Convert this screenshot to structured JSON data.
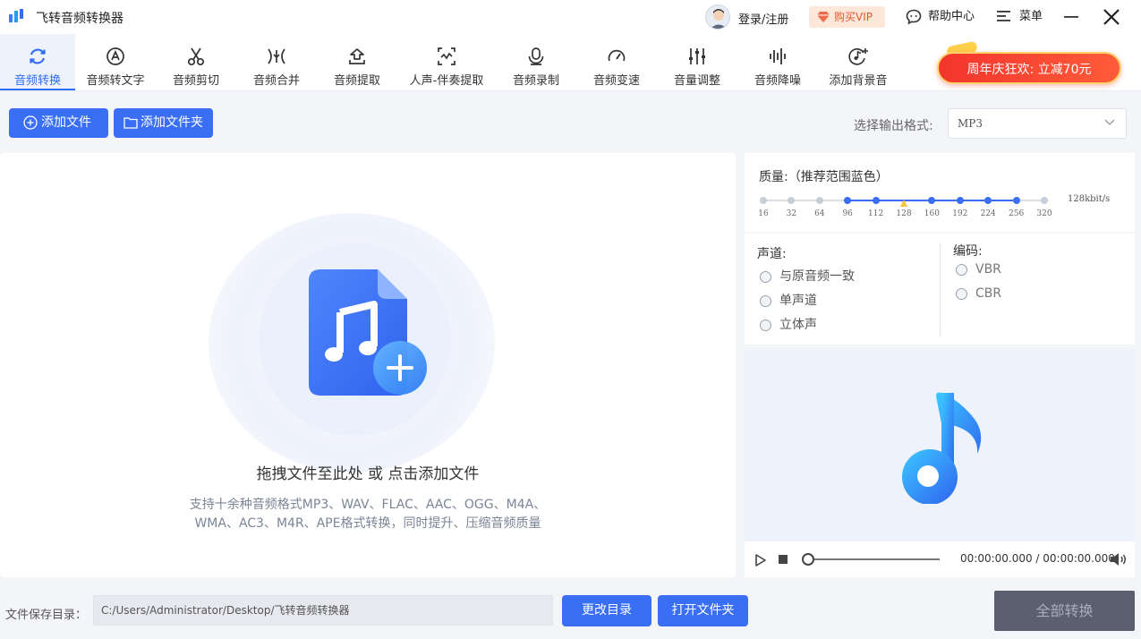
{
  "app": {
    "title": "飞转音频转换器"
  },
  "header": {
    "login": "登录/注册",
    "vip": "购买VIP",
    "help": "帮助中心",
    "menu": "菜单"
  },
  "toolbar": {
    "tools": [
      {
        "label": "音频转换",
        "icon": "sync-icon",
        "active": true
      },
      {
        "label": "音频转文字",
        "icon": "audio-to-text-icon"
      },
      {
        "label": "音频剪切",
        "icon": "scissors-icon"
      },
      {
        "label": "音频合并",
        "icon": "merge-icon"
      },
      {
        "label": "音频提取",
        "icon": "extract-icon"
      },
      {
        "label": "人声-伴奏提取",
        "icon": "vocal-separation-icon"
      },
      {
        "label": "音频录制",
        "icon": "microphone-icon"
      },
      {
        "label": "音频变速",
        "icon": "speedometer-icon"
      },
      {
        "label": "音量调整",
        "icon": "sliders-icon"
      },
      {
        "label": "音频降噪",
        "icon": "waveform-icon"
      },
      {
        "label": "添加背景音",
        "icon": "add-background-music-icon"
      }
    ],
    "promo": "周年庆狂欢: 立减70元"
  },
  "actions": {
    "add_file": "添加文件",
    "add_folder": "添加文件夹",
    "format_label": "选择输出格式:",
    "format_value": "MP3"
  },
  "dropzone": {
    "title": "拖拽文件至此处 或 点击添加文件",
    "sub1": "支持十余种音频格式MP3、WAV、FLAC、AAC、OGG、M4A、",
    "sub2": "WMA、AC3、M4R、APE格式转换，同时提升、压缩音频质量"
  },
  "quality": {
    "title": "质量:（推荐范围蓝色）",
    "ticks": [
      "16",
      "32",
      "64",
      "96",
      "112",
      "128",
      "160",
      "192",
      "224",
      "256",
      "320"
    ],
    "selected": "128",
    "value_text": "128kbit/s",
    "colors": {
      "accent": "#3a6ff5",
      "inactive": "#c9ced9",
      "selected": "#f5c242"
    }
  },
  "channel": {
    "title": "声道:",
    "options": [
      "与原音频一致",
      "单声道",
      "立体声"
    ]
  },
  "encoding": {
    "title": "编码:",
    "options": [
      "VBR",
      "CBR"
    ]
  },
  "player": {
    "time": "00:00:00.000 / 00:00:00.000"
  },
  "footer": {
    "save_label": "文件保存目录：",
    "save_path": "C:/Users/Administrator/Desktop/飞转音频转换器",
    "change_dir": "更改目录",
    "open_folder": "打开文件夹",
    "convert_all": "全部转换"
  }
}
